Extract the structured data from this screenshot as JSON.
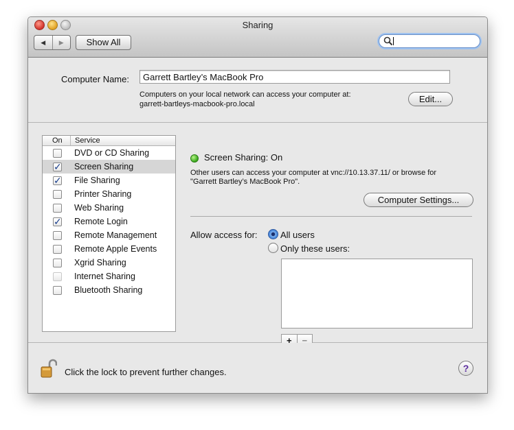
{
  "window": {
    "title": "Sharing"
  },
  "toolbar": {
    "back_icon": "◀",
    "forward_icon": "▶",
    "show_all_label": "Show All",
    "search_value": ""
  },
  "computer_name": {
    "label": "Computer Name:",
    "value": "Garrett Bartley’s MacBook Pro",
    "description_line1": "Computers on your local network can access your computer at:",
    "description_line2": "garrett-bartleys-macbook-pro.local",
    "edit_label": "Edit..."
  },
  "services": {
    "header_on": "On",
    "header_service": "Service",
    "items": [
      {
        "label": "DVD or CD Sharing",
        "checked": false,
        "selected": false,
        "enabled": true
      },
      {
        "label": "Screen Sharing",
        "checked": true,
        "selected": true,
        "enabled": true
      },
      {
        "label": "File Sharing",
        "checked": true,
        "selected": false,
        "enabled": true
      },
      {
        "label": "Printer Sharing",
        "checked": false,
        "selected": false,
        "enabled": true
      },
      {
        "label": "Web Sharing",
        "checked": false,
        "selected": false,
        "enabled": true
      },
      {
        "label": "Remote Login",
        "checked": true,
        "selected": false,
        "enabled": true
      },
      {
        "label": "Remote Management",
        "checked": false,
        "selected": false,
        "enabled": true
      },
      {
        "label": "Remote Apple Events",
        "checked": false,
        "selected": false,
        "enabled": true
      },
      {
        "label": "Xgrid Sharing",
        "checked": false,
        "selected": false,
        "enabled": true
      },
      {
        "label": "Internet Sharing",
        "checked": false,
        "selected": false,
        "enabled": false
      },
      {
        "label": "Bluetooth Sharing",
        "checked": false,
        "selected": false,
        "enabled": true
      }
    ]
  },
  "detail": {
    "status": "Screen Sharing: On",
    "status_color": "#36a81a",
    "info_line1": "Other users can access your computer at vnc://10.13.37.11/ or browse for",
    "info_line2": "\"Garrett Bartley’s MacBook Pro\".",
    "computer_settings_label": "Computer Settings...",
    "allow_label": "Allow access for:",
    "option_all": "All users",
    "option_only": "Only these users:",
    "selected_option": "All users",
    "add_label": "+",
    "remove_label": "−"
  },
  "footer": {
    "lock_text": "Click the lock to prevent further changes.",
    "help_label": "?"
  }
}
